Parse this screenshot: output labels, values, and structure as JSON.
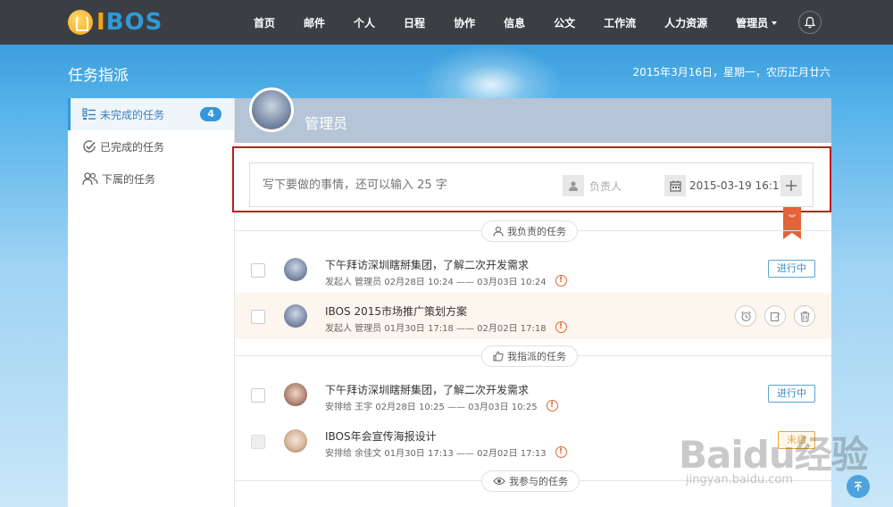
{
  "brand": {
    "logo_text_a": "I",
    "logo_text_b": "BOS"
  },
  "nav": {
    "items": [
      "首页",
      "邮件",
      "个人",
      "日程",
      "协作",
      "信息",
      "公文",
      "工作流",
      "人力资源"
    ],
    "admin_label": "管理员"
  },
  "header": {
    "title": "任务指派",
    "date": "2015年3月16日，星期一，农历正月廿六"
  },
  "sidebar": {
    "items": [
      {
        "label": "未完成的任务",
        "count": "4"
      },
      {
        "label": "已完成的任务"
      },
      {
        "label": "下属的任务"
      }
    ]
  },
  "user": {
    "name": "管理员"
  },
  "composer": {
    "placeholder": "写下要做的事情，还可以输入 25 字",
    "owner_label": "负责人",
    "datetime": "2015-03-19 16:17"
  },
  "sections": {
    "mine": "我负责的任务",
    "assigned": "我指派的任务",
    "joined": "我参与的任务"
  },
  "tasks": [
    {
      "title": "下午拜访深圳瞎掰集团，了解二次开发需求",
      "meta": "发起人 管理员 02月28日 10:24 —— 03月03日 10:24",
      "status": "进行中"
    },
    {
      "title": "IBOS 2015市场推广策划方案",
      "meta": "发起人 管理员 01月30日 17:18 —— 02月02日 17:18"
    },
    {
      "title": "下午拜访深圳瞎掰集团，了解二次开发需求",
      "meta": "安排给 王宇 02月28日 10:25 —— 03月03日 10:25",
      "status": "进行中"
    },
    {
      "title": "IBOS年会宣传海报设计",
      "meta": "安排给 余佳文 01月30日 17:13 —— 02月02日 17:13",
      "status": "未启"
    }
  ],
  "watermark": {
    "text": "Baidu经验",
    "sub": "jingyan.baidu.com"
  },
  "colors": {
    "accent": "#3497db",
    "warning": "#e0652f",
    "highlight_border": "#c11919",
    "topbar": "#3b3f44"
  }
}
